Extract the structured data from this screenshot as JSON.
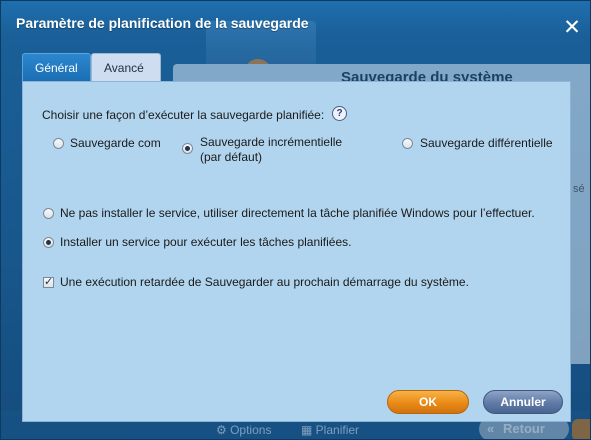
{
  "dialog": {
    "title": "Paramètre de planification de la sauvegarde",
    "close_glyph": "✕"
  },
  "background": {
    "panel_title": "Sauvegarde du système",
    "row_text": "sé",
    "options_label": "Options",
    "schedule_label": "Planifier",
    "back_label": "Retour"
  },
  "tabs": [
    {
      "label": "Général",
      "active": true
    },
    {
      "label": "Avancé",
      "active": false
    }
  ],
  "content": {
    "choose_label": "Choisir une façon d’exécuter la sauvegarde planifiée:",
    "help_glyph": "?",
    "backup_types": [
      {
        "label": "Sauvegarde com",
        "checked": false
      },
      {
        "label_line1": "Sauvegarde incrémentielle",
        "label_line2": "(par défaut)",
        "checked": true
      },
      {
        "label": "Sauvegarde différentielle",
        "checked": false
      }
    ],
    "service_options": [
      {
        "label": "Ne pas installer le service, utiliser directement la tâche planifiée Windows pour l’effectuer.",
        "checked": false
      },
      {
        "label": "Installer un service pour exécuter les tâches planifiées.",
        "checked": true
      }
    ],
    "delayed_run": {
      "label": "Une exécution retardée de Sauvegarder au prochain démarrage du système.",
      "checked": true
    }
  },
  "buttons": {
    "ok_label": "OK",
    "cancel_label": "Annuler"
  },
  "colors": {
    "accent_ok": "#e98a16",
    "accent_cancel": "#5f7aa6",
    "panel_bg": "#b1d5ef",
    "title_bar": "#1a5f98"
  }
}
